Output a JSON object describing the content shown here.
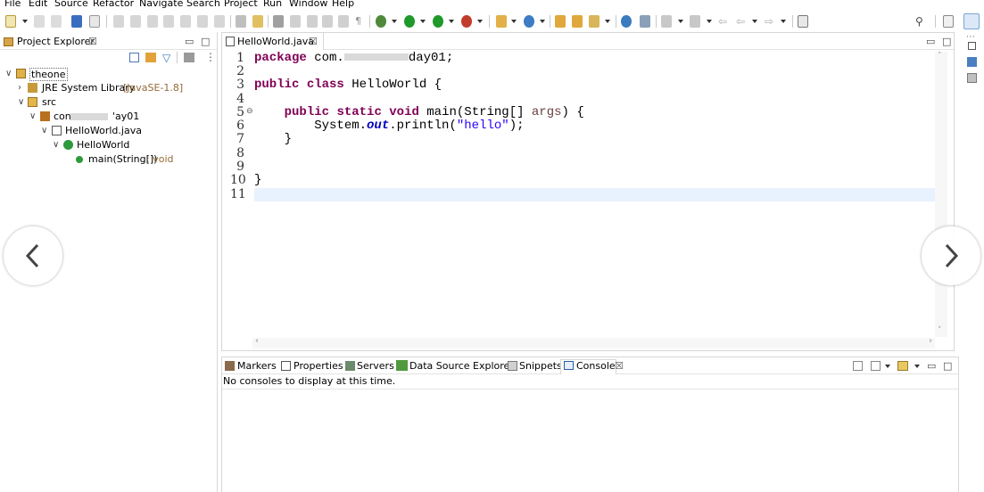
{
  "menu": [
    "File",
    "Edit",
    "Source",
    "Refactor",
    "Navigate",
    "Search",
    "Project",
    "Run",
    "Window",
    "Help"
  ],
  "explorer": {
    "title": "Project Explorer",
    "close_glyph": "☒",
    "tree": [
      {
        "label": "theone",
        "suffix": ""
      },
      {
        "label": "JRE System Library",
        "suffix": "[JavaSE-1.8]"
      },
      {
        "label": "src",
        "suffix": ""
      },
      {
        "label": "con",
        "suffix": "'ay01"
      },
      {
        "label": "HelloWorld.java",
        "suffix": ""
      },
      {
        "label": "HelloWorld",
        "suffix": ""
      },
      {
        "label": "main(String[])",
        "suffix": ": void"
      }
    ]
  },
  "editor": {
    "tab_title": "HelloWorld.java",
    "close_glyph": "☒",
    "line_numbers": [
      "1",
      "2",
      "3",
      "4",
      "5",
      "6",
      "7",
      "8",
      "9",
      "10",
      "11"
    ],
    "code": {
      "l1_kw": "package",
      "l1_a": "com.",
      "l1_b": "day01;",
      "l3_kw1": "public",
      "l3_kw2": "class",
      "l3_rest": "HelloWorld {",
      "l5_kw1": "public",
      "l5_kw2": "static",
      "l5_kw3": "void",
      "l5_rest": "main(String[]",
      "l5_var": "args",
      "l5_end": ") {",
      "l6_a": "System.",
      "l6_fld": "out",
      "l6_b": ".println(",
      "l6_str": "\"hello\"",
      "l6_end": ");",
      "l7": "}",
      "l10": "}"
    }
  },
  "console": {
    "tabs": [
      "Markers",
      "Properties",
      "Servers",
      "Data Source Explorer",
      "Snippets",
      "Console"
    ],
    "close_glyph": "☒",
    "message": "No consoles to display at this time."
  },
  "colors": {
    "keyword": "#7f0055",
    "string": "#2a00ff",
    "field": "#0000c0",
    "current_line": "#e8f2fe"
  }
}
